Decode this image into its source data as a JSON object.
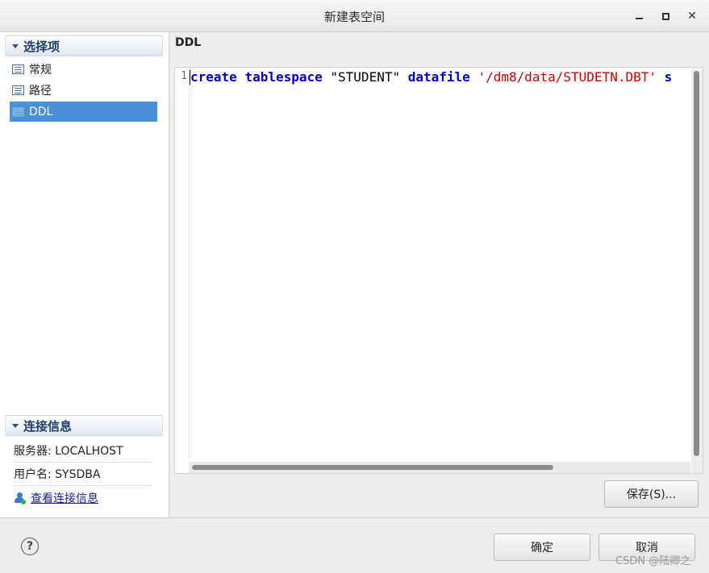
{
  "window": {
    "title": "新建表空间",
    "icons": {
      "minimize": "minimize-icon",
      "maximize": "maximize-icon",
      "close": "close-icon"
    }
  },
  "sidebar": {
    "options_header": "选择项",
    "items": [
      {
        "label": "常规",
        "icon": "form-icon",
        "selected": false
      },
      {
        "label": "路径",
        "icon": "form-icon",
        "selected": false
      },
      {
        "label": "DDL",
        "icon": "form-icon",
        "selected": true
      }
    ],
    "connection_header": "连接信息",
    "server_label": "服务器: LOCALHOST",
    "user_label": "用户名: SYSDBA",
    "view_connection_label": "查看连接信息"
  },
  "main": {
    "section_title": "DDL",
    "editor": {
      "line_number": "1",
      "tokens": [
        {
          "text": "create",
          "type": "keyword"
        },
        {
          "text": " ",
          "type": "plain"
        },
        {
          "text": "tablespace",
          "type": "keyword"
        },
        {
          "text": " \"STUDENT\" ",
          "type": "plain"
        },
        {
          "text": "datafile",
          "type": "keyword"
        },
        {
          "text": " ",
          "type": "plain"
        },
        {
          "text": "'/dm8/data/STUDETN.DBT'",
          "type": "string"
        },
        {
          "text": " ",
          "type": "plain"
        },
        {
          "text": "s",
          "type": "keyword"
        }
      ]
    },
    "save_button": "保存(S)..."
  },
  "footer": {
    "help_symbol": "?",
    "ok_button": "确定",
    "cancel_button": "取消",
    "watermark": "CSDN @陆卿之"
  },
  "colors": {
    "keyword": "#0000c8",
    "string": "#d00000",
    "selection": "#4a90d9"
  }
}
